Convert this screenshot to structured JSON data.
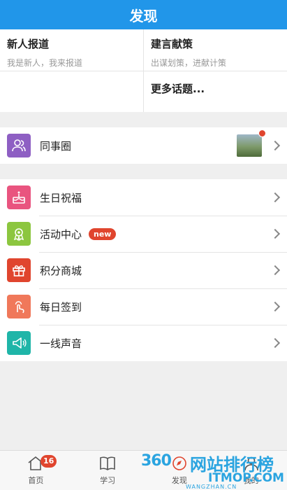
{
  "header": {
    "title": "发现"
  },
  "topics": {
    "left": {
      "title": "新人报道",
      "subtitle": "我是新人，我来报道"
    },
    "right": {
      "title": "建言献策",
      "subtitle": "出谋划策，进献计策"
    },
    "more": "更多话题..."
  },
  "circle": {
    "label": "同事圈"
  },
  "menu": [
    {
      "label": "生日祝福",
      "icon": "cake-icon",
      "color": "#e9547f"
    },
    {
      "label": "活动中心",
      "icon": "activity-icon",
      "color": "#8cc63f",
      "badge": "new"
    },
    {
      "label": "积分商城",
      "icon": "gift-icon",
      "color": "#e0452e"
    },
    {
      "label": "每日签到",
      "icon": "tap-icon",
      "color": "#f0785a"
    },
    {
      "label": "一线声音",
      "icon": "megaphone-icon",
      "color": "#1fb5a8"
    }
  ],
  "tabbar": {
    "home": {
      "label": "首页",
      "badge": "16"
    },
    "study": {
      "label": "学习"
    },
    "discover": {
      "label": "发现"
    },
    "mine": {
      "label": "我的"
    }
  },
  "watermark": {
    "brand": "360",
    "text": "网站排行榜",
    "url": "ITMOP.COM",
    "sub": "WANGZHAN.CN"
  },
  "colors": {
    "accent": "#2196e9",
    "badge": "#e0452e"
  }
}
